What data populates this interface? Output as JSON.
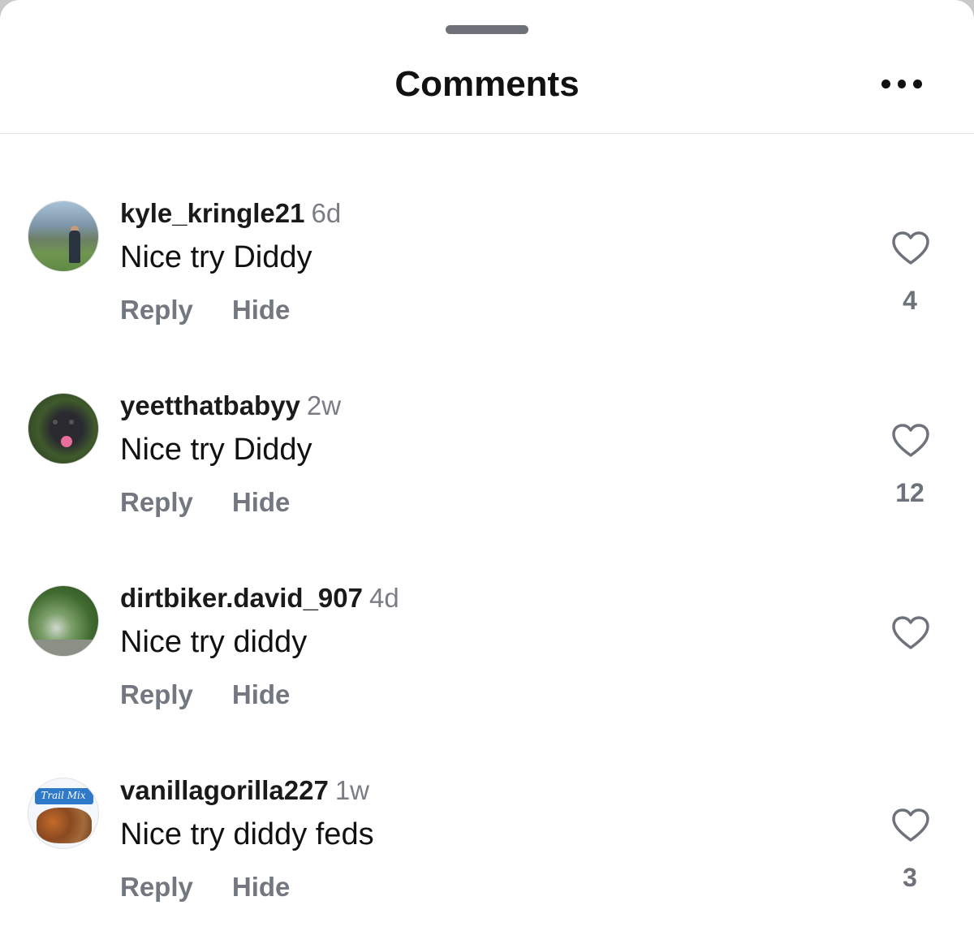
{
  "header": {
    "title": "Comments",
    "more_icon": "more-horizontal-icon"
  },
  "comments": [
    {
      "username": "kyle_kringle21",
      "time": "6d",
      "text": "Nice try Diddy",
      "reply_label": "Reply",
      "hide_label": "Hide",
      "likes": "4"
    },
    {
      "username": "yeetthatbabyy",
      "time": "2w",
      "text": "Nice try Diddy",
      "reply_label": "Reply",
      "hide_label": "Hide",
      "likes": "12"
    },
    {
      "username": "dirtbiker.david_907",
      "time": "4d",
      "text": "Nice try diddy",
      "reply_label": "Reply",
      "hide_label": "Hide",
      "likes": ""
    },
    {
      "username": "vanillagorilla227",
      "time": "1w",
      "text": "Nice try diddy feds",
      "reply_label": "Reply",
      "hide_label": "Hide",
      "likes": "3",
      "avatar_text": "Trail Mix"
    }
  ],
  "colors": {
    "muted": "#727780",
    "text": "#111111",
    "divider": "#e4e4e6"
  }
}
